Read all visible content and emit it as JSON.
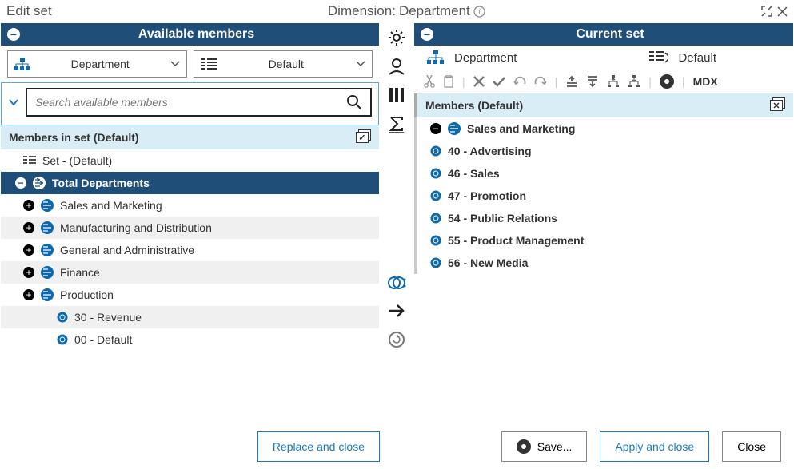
{
  "header": {
    "title": "Edit set",
    "dimension_label": "Dimension:",
    "dimension_value": "Department"
  },
  "left": {
    "panel_title": "Available members",
    "selector_hierarchy": "Department",
    "selector_view": "Default",
    "search_placeholder": "Search available members",
    "members_header": "Members in set (Default)",
    "set_row": "Set - (Default)",
    "total_row": "Total Departments",
    "items": {
      "sales_marketing": "Sales and Marketing",
      "manufacturing": "Manufacturing and Distribution",
      "general_admin": "General and Administrative",
      "finance": "Finance",
      "production": "Production",
      "revenue": "30 - Revenue",
      "default": "00 - Default"
    }
  },
  "right": {
    "panel_title": "Current set",
    "selector_hierarchy": "Department",
    "selector_view": "Default",
    "mdx": "MDX",
    "members_header": "Members (Default)",
    "parent": "Sales and Marketing",
    "children": {
      "advertising": "40 - Advertising",
      "sales": "46 - Sales",
      "promotion": "47 - Promotion",
      "public_relations": "54 - Public Relations",
      "product_mgmt": "55 - Product Management",
      "new_media": "56 - New Media"
    }
  },
  "buttons": {
    "replace_close": "Replace and close",
    "save": "Save...",
    "apply_close": "Apply and close",
    "close": "Close"
  }
}
